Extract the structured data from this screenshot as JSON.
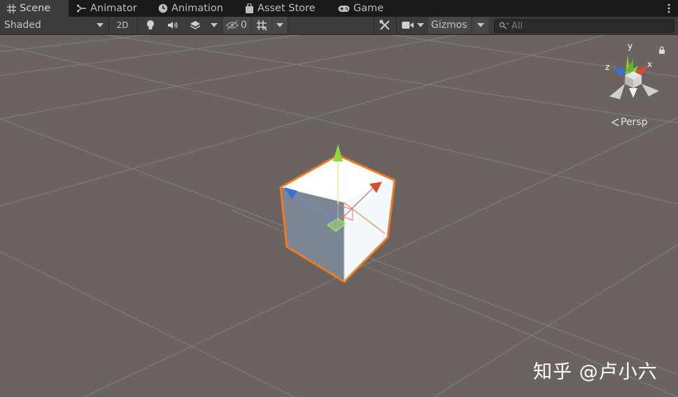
{
  "tabs": [
    {
      "label": "Scene",
      "icon": "grid-icon"
    },
    {
      "label": "Animator",
      "icon": "animator-icon"
    },
    {
      "label": "Animation",
      "icon": "clock-icon"
    },
    {
      "label": "Asset Store",
      "icon": "store-bag-icon"
    },
    {
      "label": "Game",
      "icon": "gamepad-icon"
    }
  ],
  "toolbar": {
    "shading_mode": "Shaded",
    "mode_2d": "2D",
    "hidden_count": "0",
    "gizmos": "Gizmos",
    "search_placeholder": "All"
  },
  "scene": {
    "projection": "Persp",
    "gizmo_axes": [
      "y",
      "z",
      "x"
    ],
    "colors": {
      "background": "#6a6360",
      "selection_outline": "#f07a22",
      "axis_x": "#dc4a2f",
      "axis_y": "#8fd93a",
      "axis_z": "#3a6fd6"
    }
  },
  "watermark": "知乎 @卢小六"
}
